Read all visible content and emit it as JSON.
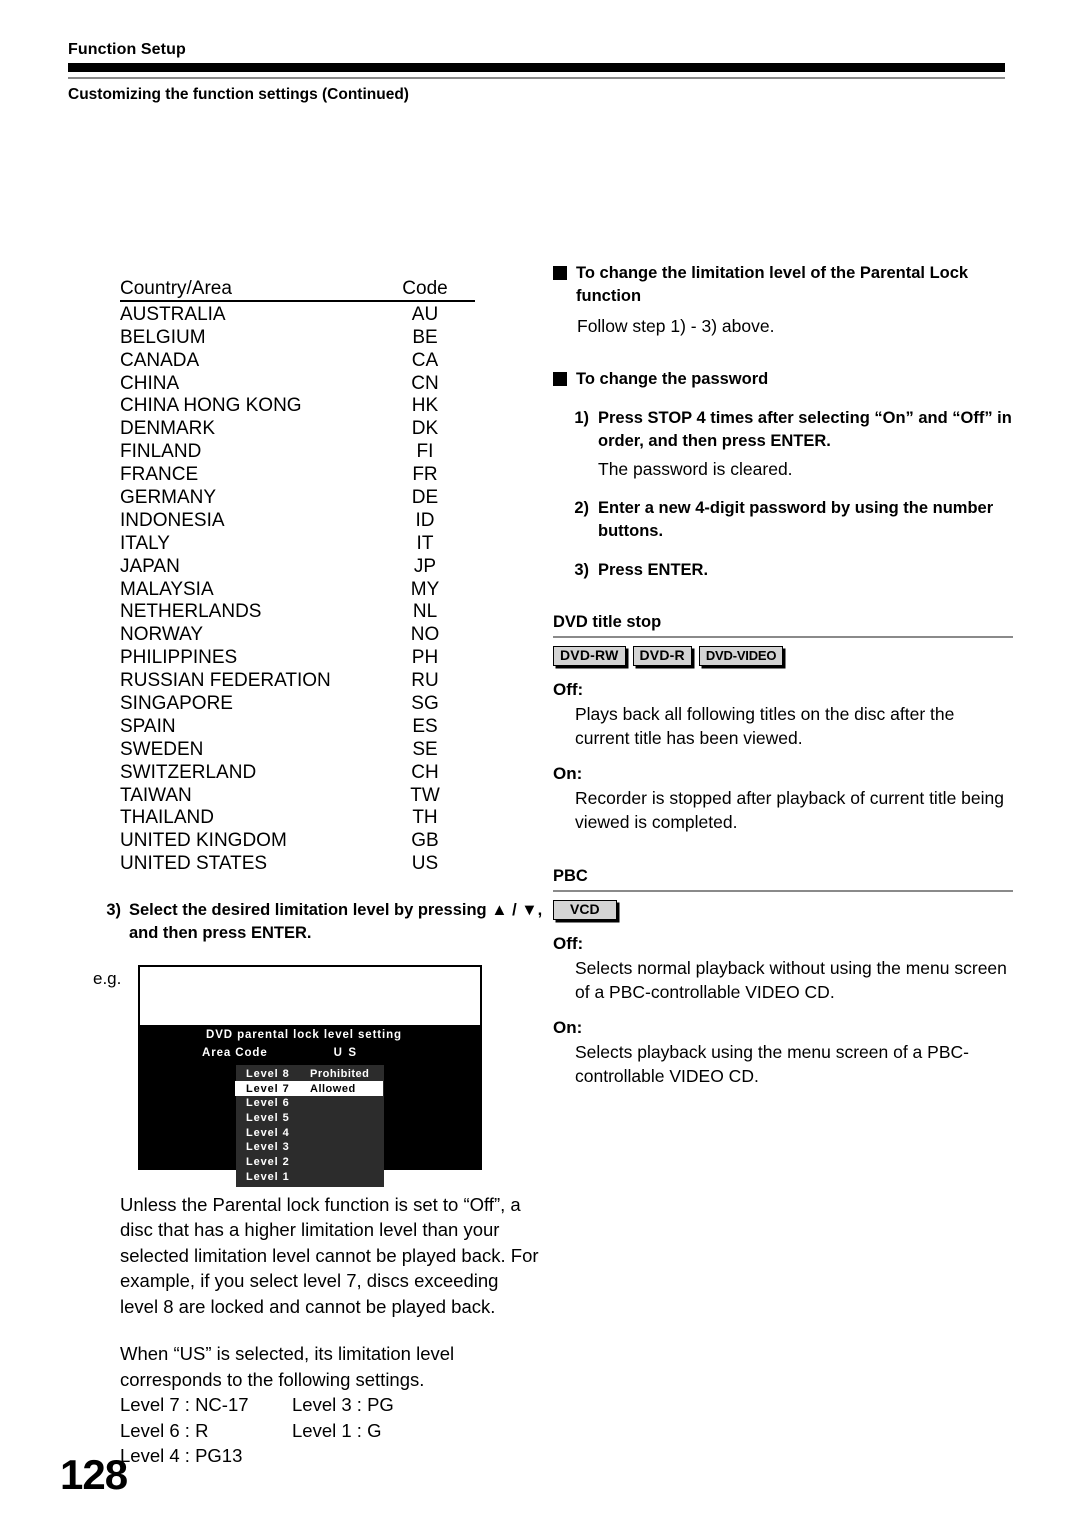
{
  "header": {
    "title": "Function Setup",
    "subtitle": "Customizing the function settings (Continued)"
  },
  "country_table": {
    "header_country": "Country/Area",
    "header_code": "Code",
    "rows": [
      {
        "country": "AUSTRALIA",
        "code": "AU"
      },
      {
        "country": "BELGIUM",
        "code": "BE"
      },
      {
        "country": "CANADA",
        "code": "CA"
      },
      {
        "country": "CHINA",
        "code": "CN"
      },
      {
        "country": "CHINA HONG KONG",
        "code": "HK"
      },
      {
        "country": "DENMARK",
        "code": "DK"
      },
      {
        "country": "FINLAND",
        "code": "FI"
      },
      {
        "country": "FRANCE",
        "code": "FR"
      },
      {
        "country": "GERMANY",
        "code": "DE"
      },
      {
        "country": "INDONESIA",
        "code": "ID"
      },
      {
        "country": "ITALY",
        "code": "IT"
      },
      {
        "country": "JAPAN",
        "code": "JP"
      },
      {
        "country": "MALAYSIA",
        "code": "MY"
      },
      {
        "country": "NETHERLANDS",
        "code": "NL"
      },
      {
        "country": "NORWAY",
        "code": "NO"
      },
      {
        "country": "PHILIPPINES",
        "code": "PH"
      },
      {
        "country": "RUSSIAN FEDERATION",
        "code": "RU"
      },
      {
        "country": "SINGAPORE",
        "code": "SG"
      },
      {
        "country": "SPAIN",
        "code": "ES"
      },
      {
        "country": "SWEDEN",
        "code": "SE"
      },
      {
        "country": "SWITZERLAND",
        "code": "CH"
      },
      {
        "country": "TAIWAN",
        "code": "TW"
      },
      {
        "country": "THAILAND",
        "code": "TH"
      },
      {
        "country": "UNITED KINGDOM",
        "code": "GB"
      },
      {
        "country": "UNITED STATES",
        "code": "US"
      }
    ]
  },
  "step3": {
    "number": "3)",
    "text": "Select the desired limitation level by pressing ▲ / ▼, and then press ENTER."
  },
  "example": {
    "label": "e.g.",
    "screen": {
      "heading": "DVD parental lock level setting",
      "area_code_label": "Area Code",
      "area_code_value": "U S",
      "levels": [
        {
          "name": "Level 8",
          "state": "Prohibited",
          "selected": false
        },
        {
          "name": "Level 7",
          "state": "Allowed",
          "selected": true
        },
        {
          "name": "Level 6",
          "state": "",
          "selected": false
        },
        {
          "name": "Level 5",
          "state": "",
          "selected": false
        },
        {
          "name": "Level 4",
          "state": "",
          "selected": false
        },
        {
          "name": "Level 3",
          "state": "",
          "selected": false
        },
        {
          "name": "Level 2",
          "state": "",
          "selected": false
        },
        {
          "name": "Level 1",
          "state": "",
          "selected": false
        }
      ]
    }
  },
  "left_notes": {
    "paragraph1": "Unless the Parental lock function is set to “Off”, a disc that has a higher limitation level than your selected limitation level cannot be played back. For example, if you select level 7, discs exceeding  level 8 are locked and cannot be played back.",
    "paragraph2": "When “US” is selected, its limitation level corresponds to the following settings.",
    "level_map": [
      {
        "left": "Level 7 : NC-17",
        "right": "Level 3 : PG"
      },
      {
        "left": "Level 6 : R",
        "right": "Level 1 : G"
      },
      {
        "left": "Level 4 : PG13",
        "right": ""
      }
    ]
  },
  "right": {
    "limitation_heading": "To change the limitation level of the Parental Lock function",
    "limitation_note": "Follow step 1) - 3) above.",
    "password_heading": "To change the password",
    "password_steps": [
      {
        "num": "1)",
        "text": "Press STOP 4 times after selecting “On” and “Off” in order, and then press ENTER.",
        "note": "The password is cleared."
      },
      {
        "num": "2)",
        "text": "Enter a new 4-digit password by using the number buttons.",
        "note": ""
      },
      {
        "num": "3)",
        "text": "Press ENTER.",
        "note": ""
      }
    ],
    "dvd_title_stop": {
      "title": "DVD title stop",
      "badges": [
        "DVD-RW",
        "DVD-R",
        "DVD-VIDEO"
      ],
      "off_label": "Off:",
      "off_body": "Plays back all following titles on the disc after the current title has been viewed.",
      "on_label": "On:",
      "on_body": "Recorder is stopped after playback of current title being viewed is completed."
    },
    "pbc": {
      "title": "PBC",
      "badges": [
        "VCD"
      ],
      "off_label": "Off:",
      "off_body": "Selects normal playback without using the menu screen of a PBC-controllable VIDEO CD.",
      "on_label": "On:",
      "on_body": "Selects playback using the menu screen of a PBC-controllable VIDEO CD."
    }
  },
  "page_number": "128"
}
